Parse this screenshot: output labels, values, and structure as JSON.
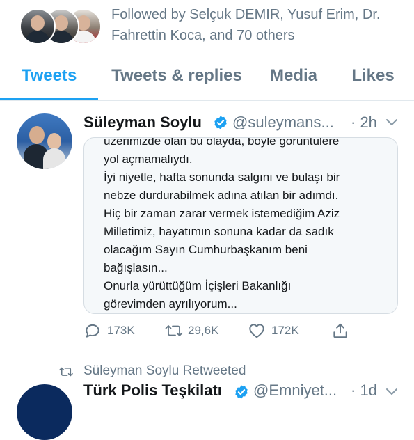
{
  "followed_by": {
    "text_line1": "Followed by Selçuk DEMIR, Yusuf Erim, Dr.",
    "text_line2": "Fahrettin Koca, and 70 others"
  },
  "tabs": [
    {
      "label": "Tweets",
      "active": true
    },
    {
      "label": "Tweets & replies",
      "active": false
    },
    {
      "label": "Media",
      "active": false
    },
    {
      "label": "Likes",
      "active": false
    }
  ],
  "tweet": {
    "name": "Süleyman Soylu",
    "handle": "@suleymans...",
    "time": "· 2h",
    "text_lines": [
      "üzerimizde olan bu olayda, böyle görüntülere",
      "yol açmamalıydı.",
      "İyi niyetle, hafta sonunda salgını ve bulaşı bir",
      "nebze durdurabilmek adına atılan bir adımdı.",
      "Hiç bir zaman zarar vermek istemediğim Aziz",
      "Milletimiz, hayatımın sonuna kadar da sadık",
      "olacağım Sayın Cumhurbaşkanım beni",
      "bağışlasın...",
      "Onurla yürüttüğüm İçişleri Bakanlığı",
      "görevimden ayrılıyorum..."
    ],
    "replies": "173K",
    "retweets": "29,6K",
    "likes": "172K"
  },
  "next_item": {
    "retweeted_label": "Süleyman Soylu Retweeted",
    "name": "Türk Polis Teşkilatı",
    "handle": "@Emniyet...",
    "time": "· 1d"
  },
  "colors": {
    "accent": "#1da1f2",
    "secondary_text": "#657786",
    "divider": "#e1e8ed"
  },
  "icons": [
    "verified-icon",
    "chevron-down-icon",
    "reply-icon",
    "retweet-icon",
    "like-icon",
    "share-icon"
  ]
}
